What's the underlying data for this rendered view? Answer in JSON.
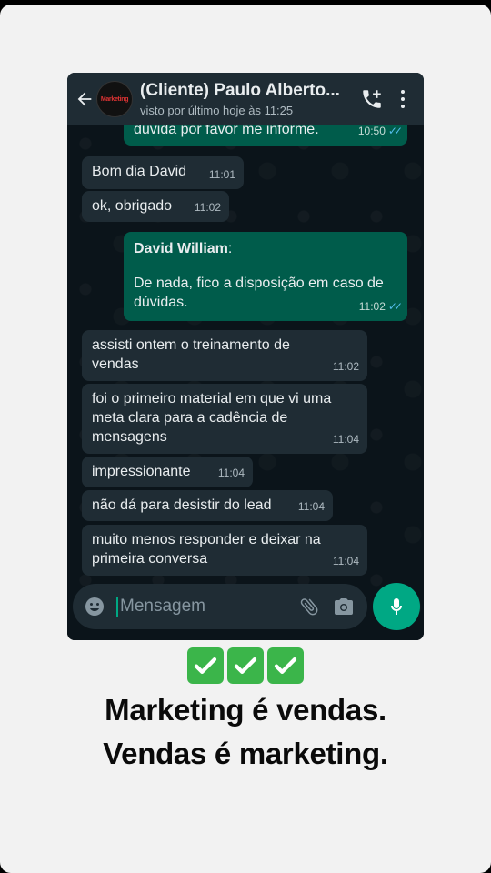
{
  "header": {
    "contact_name": "(Cliente) Paulo Alberto...",
    "status": "visto por último hoje às 11:25",
    "avatar_text": "Marketing"
  },
  "messages": [
    {
      "direction": "out",
      "text": "dúvida por favor me informe.",
      "time": "10:50",
      "ticks": "✓✓"
    },
    {
      "direction": "in",
      "text": "Bom dia David",
      "time": "11:01"
    },
    {
      "direction": "in",
      "text": "ok, obrigado",
      "time": "11:02"
    },
    {
      "direction": "out",
      "sender": "David William",
      "sender_suffix": ":",
      "text": "De nada, fico a disposição em caso de dúvidas.",
      "time": "11:02",
      "ticks": "✓✓"
    },
    {
      "direction": "in",
      "text": "assisti ontem o treinamento de vendas",
      "time": "11:02"
    },
    {
      "direction": "in",
      "text": "foi o primeiro material em que vi uma meta clara para a cadência de mensagens",
      "time": "11:04"
    },
    {
      "direction": "in",
      "text": "impressionante",
      "time": "11:04"
    },
    {
      "direction": "in",
      "text": "não dá para desistir do lead",
      "time": "11:04"
    },
    {
      "direction": "in",
      "text": "muito menos responder e deixar na primeira conversa",
      "time": "11:04"
    }
  ],
  "composer": {
    "placeholder": "Mensagem"
  },
  "caption": {
    "line1": "Marketing é vendas.",
    "line2": "Vendas é marketing."
  },
  "colors": {
    "incoming_bubble": "#1f2c34",
    "outgoing_bubble": "#005c4b",
    "accent": "#00a884",
    "read_ticks": "#53bdeb",
    "check_emoji": "#3bb54a"
  },
  "icons": [
    "back-arrow-icon",
    "add-call-icon",
    "more-vert-icon",
    "emoji-icon",
    "attach-icon",
    "camera-icon",
    "mic-icon",
    "check-mark-emoji"
  ]
}
